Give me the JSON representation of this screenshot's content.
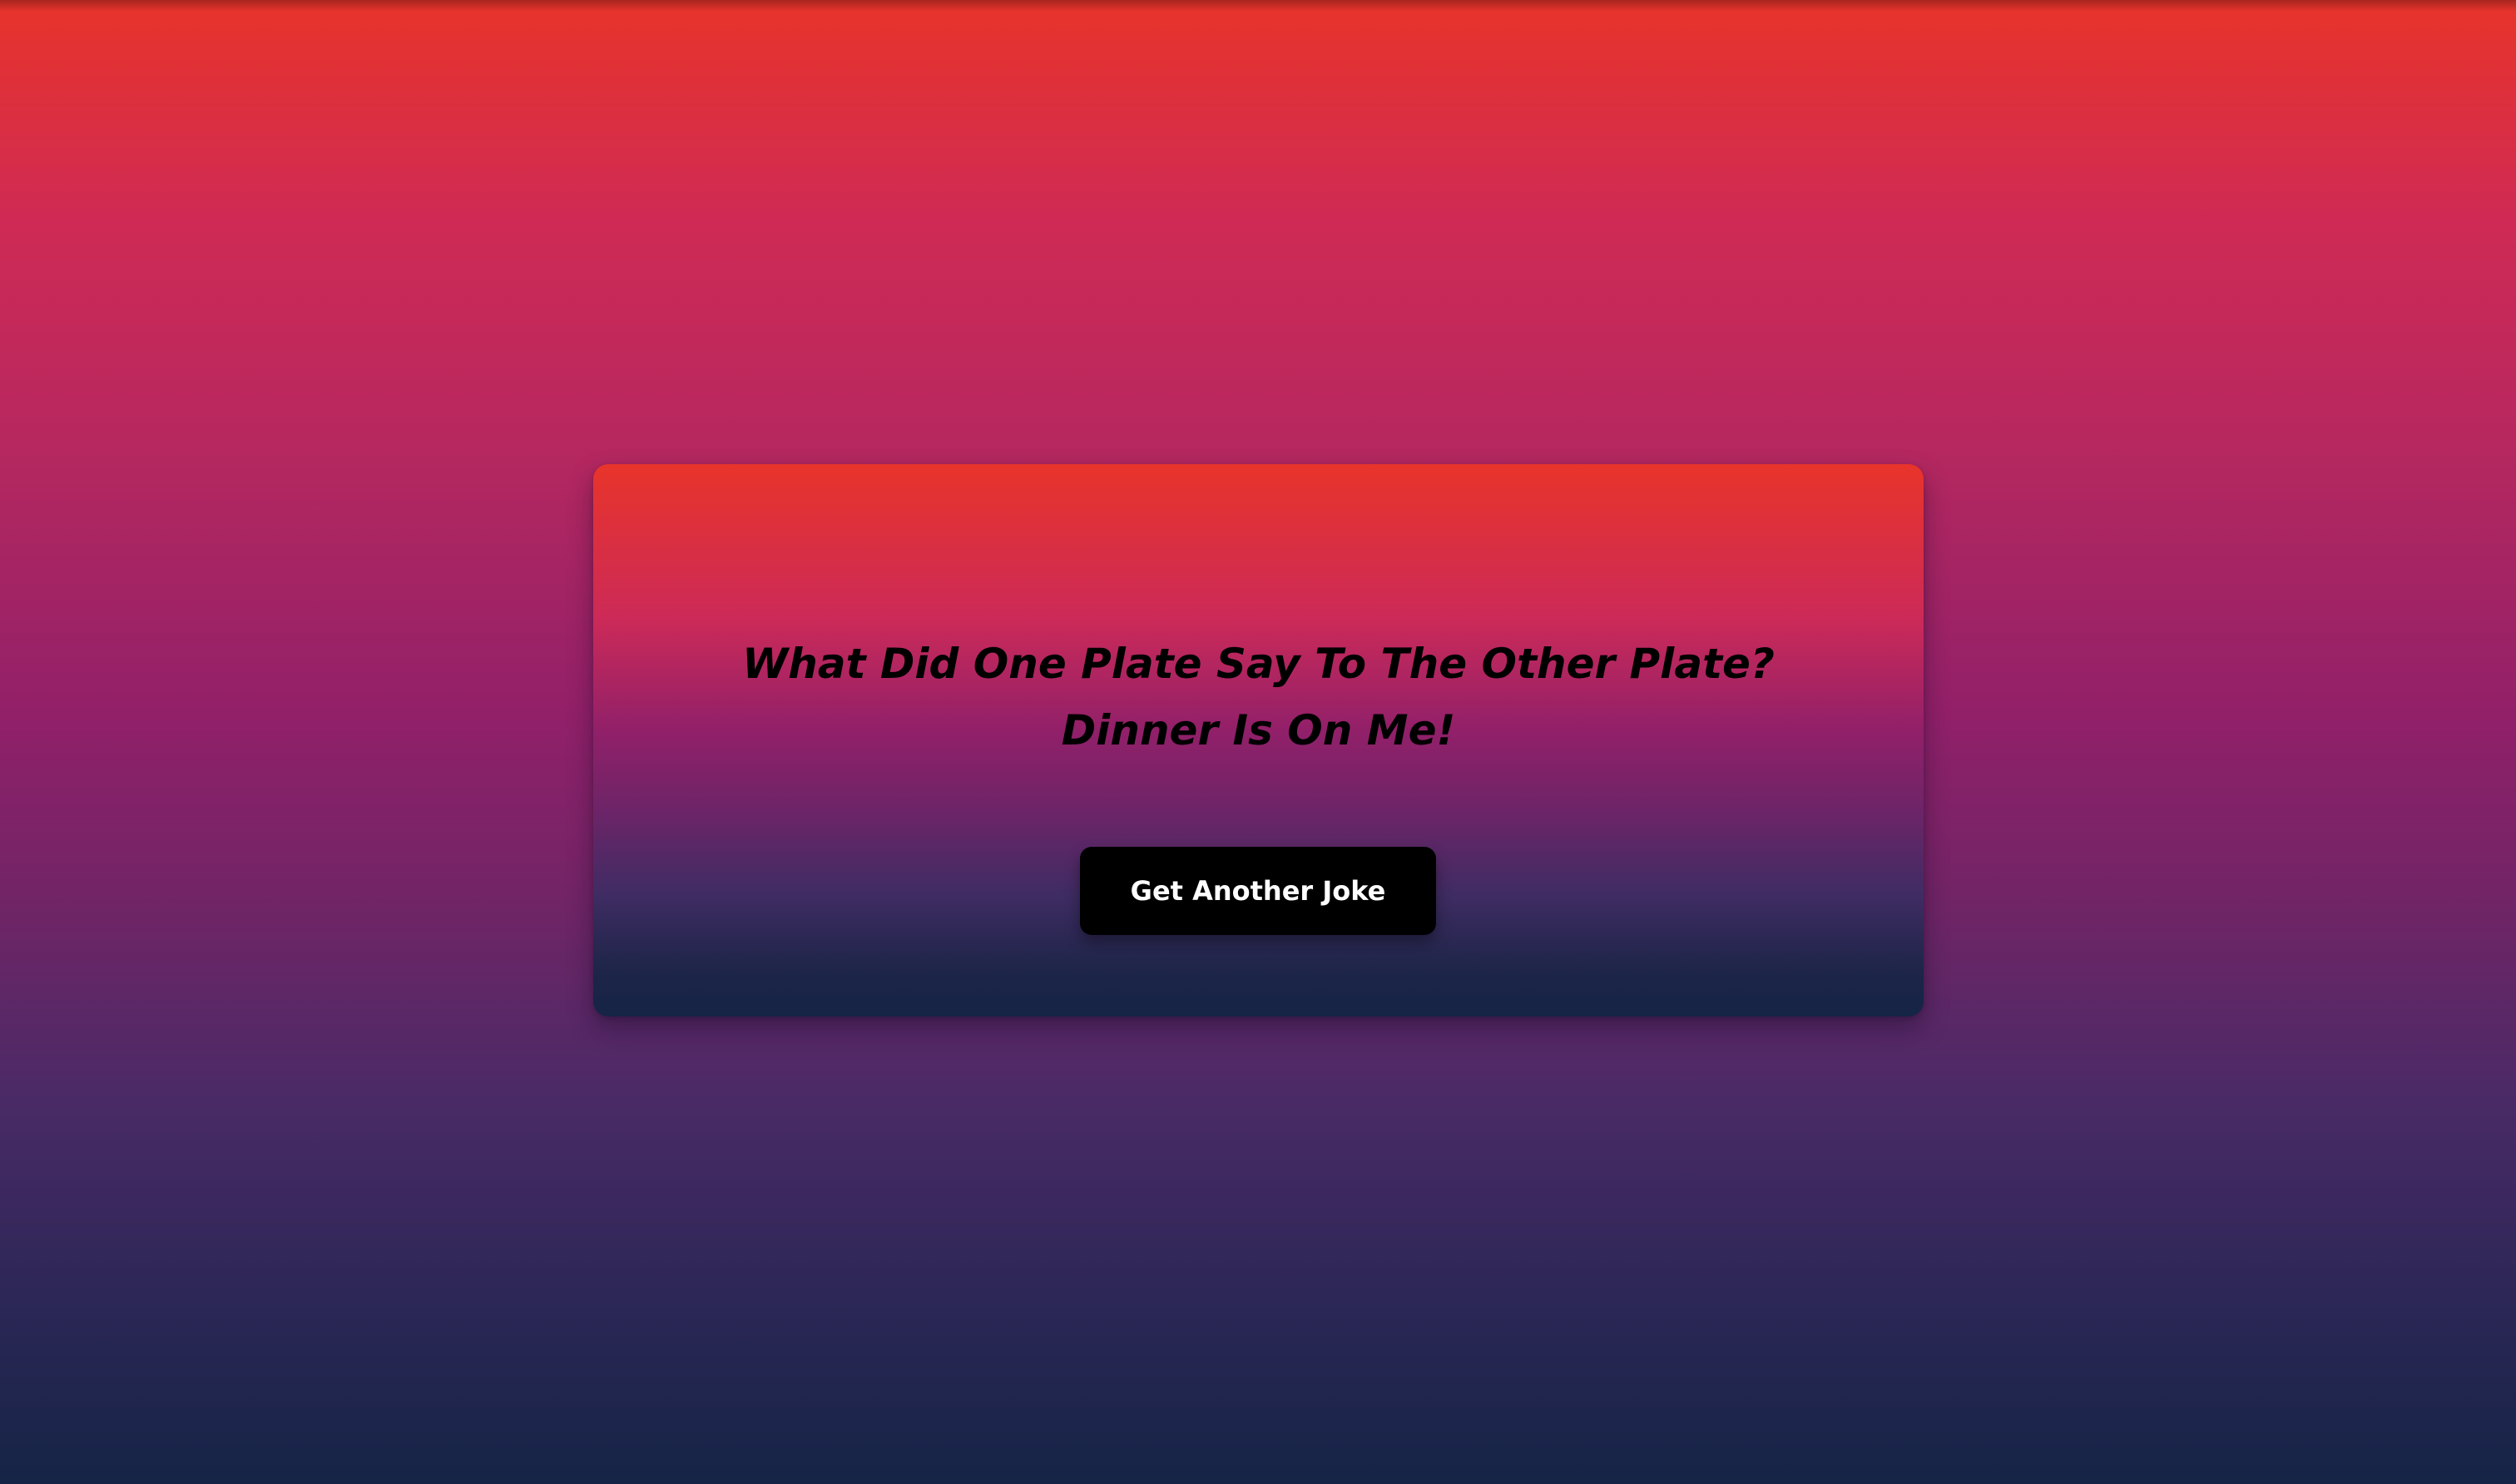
{
  "joke": {
    "question": "What Did One Plate Say To The Other Plate?",
    "answer": "Dinner Is On Me!"
  },
  "button": {
    "label": "Get Another Joke"
  },
  "colors": {
    "gradient_top": "#e8342a",
    "gradient_mid": "#922069",
    "gradient_bottom": "#152446",
    "text": "#000000",
    "button_bg": "#000000",
    "button_text": "#ffffff"
  }
}
